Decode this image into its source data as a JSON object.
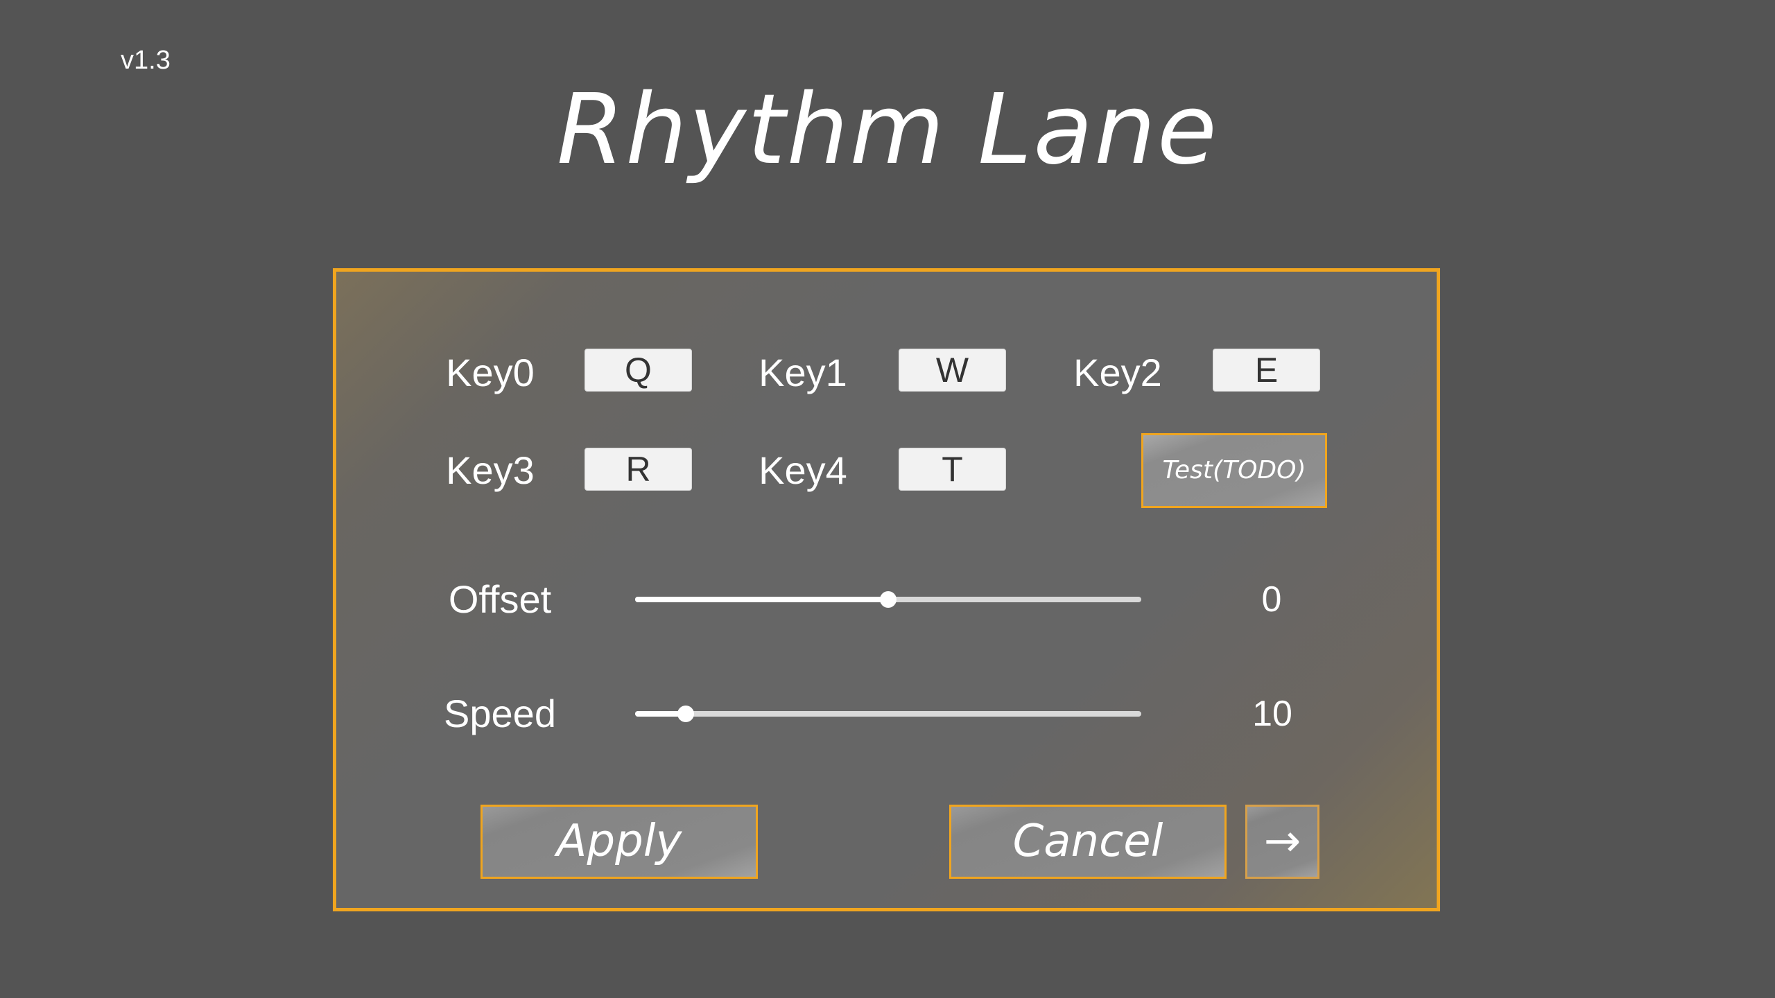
{
  "app": {
    "version": "v1.3",
    "title": "Rhythm Lane"
  },
  "keys": [
    {
      "label": "Key0",
      "value": "Q"
    },
    {
      "label": "Key1",
      "value": "W"
    },
    {
      "label": "Key2",
      "value": "E"
    },
    {
      "label": "Key3",
      "value": "R"
    },
    {
      "label": "Key4",
      "value": "T"
    }
  ],
  "test_button": {
    "label": "Test(TODO)"
  },
  "sliders": {
    "offset": {
      "label": "Offset",
      "value": "0",
      "fraction": 0.5
    },
    "speed": {
      "label": "Speed",
      "value": "10",
      "fraction": 0.1
    }
  },
  "buttons": {
    "apply": "Apply",
    "cancel": "Cancel",
    "next": "→"
  },
  "colors": {
    "background": "#545454",
    "accent": "#f0a51f",
    "panel": "#666666"
  }
}
